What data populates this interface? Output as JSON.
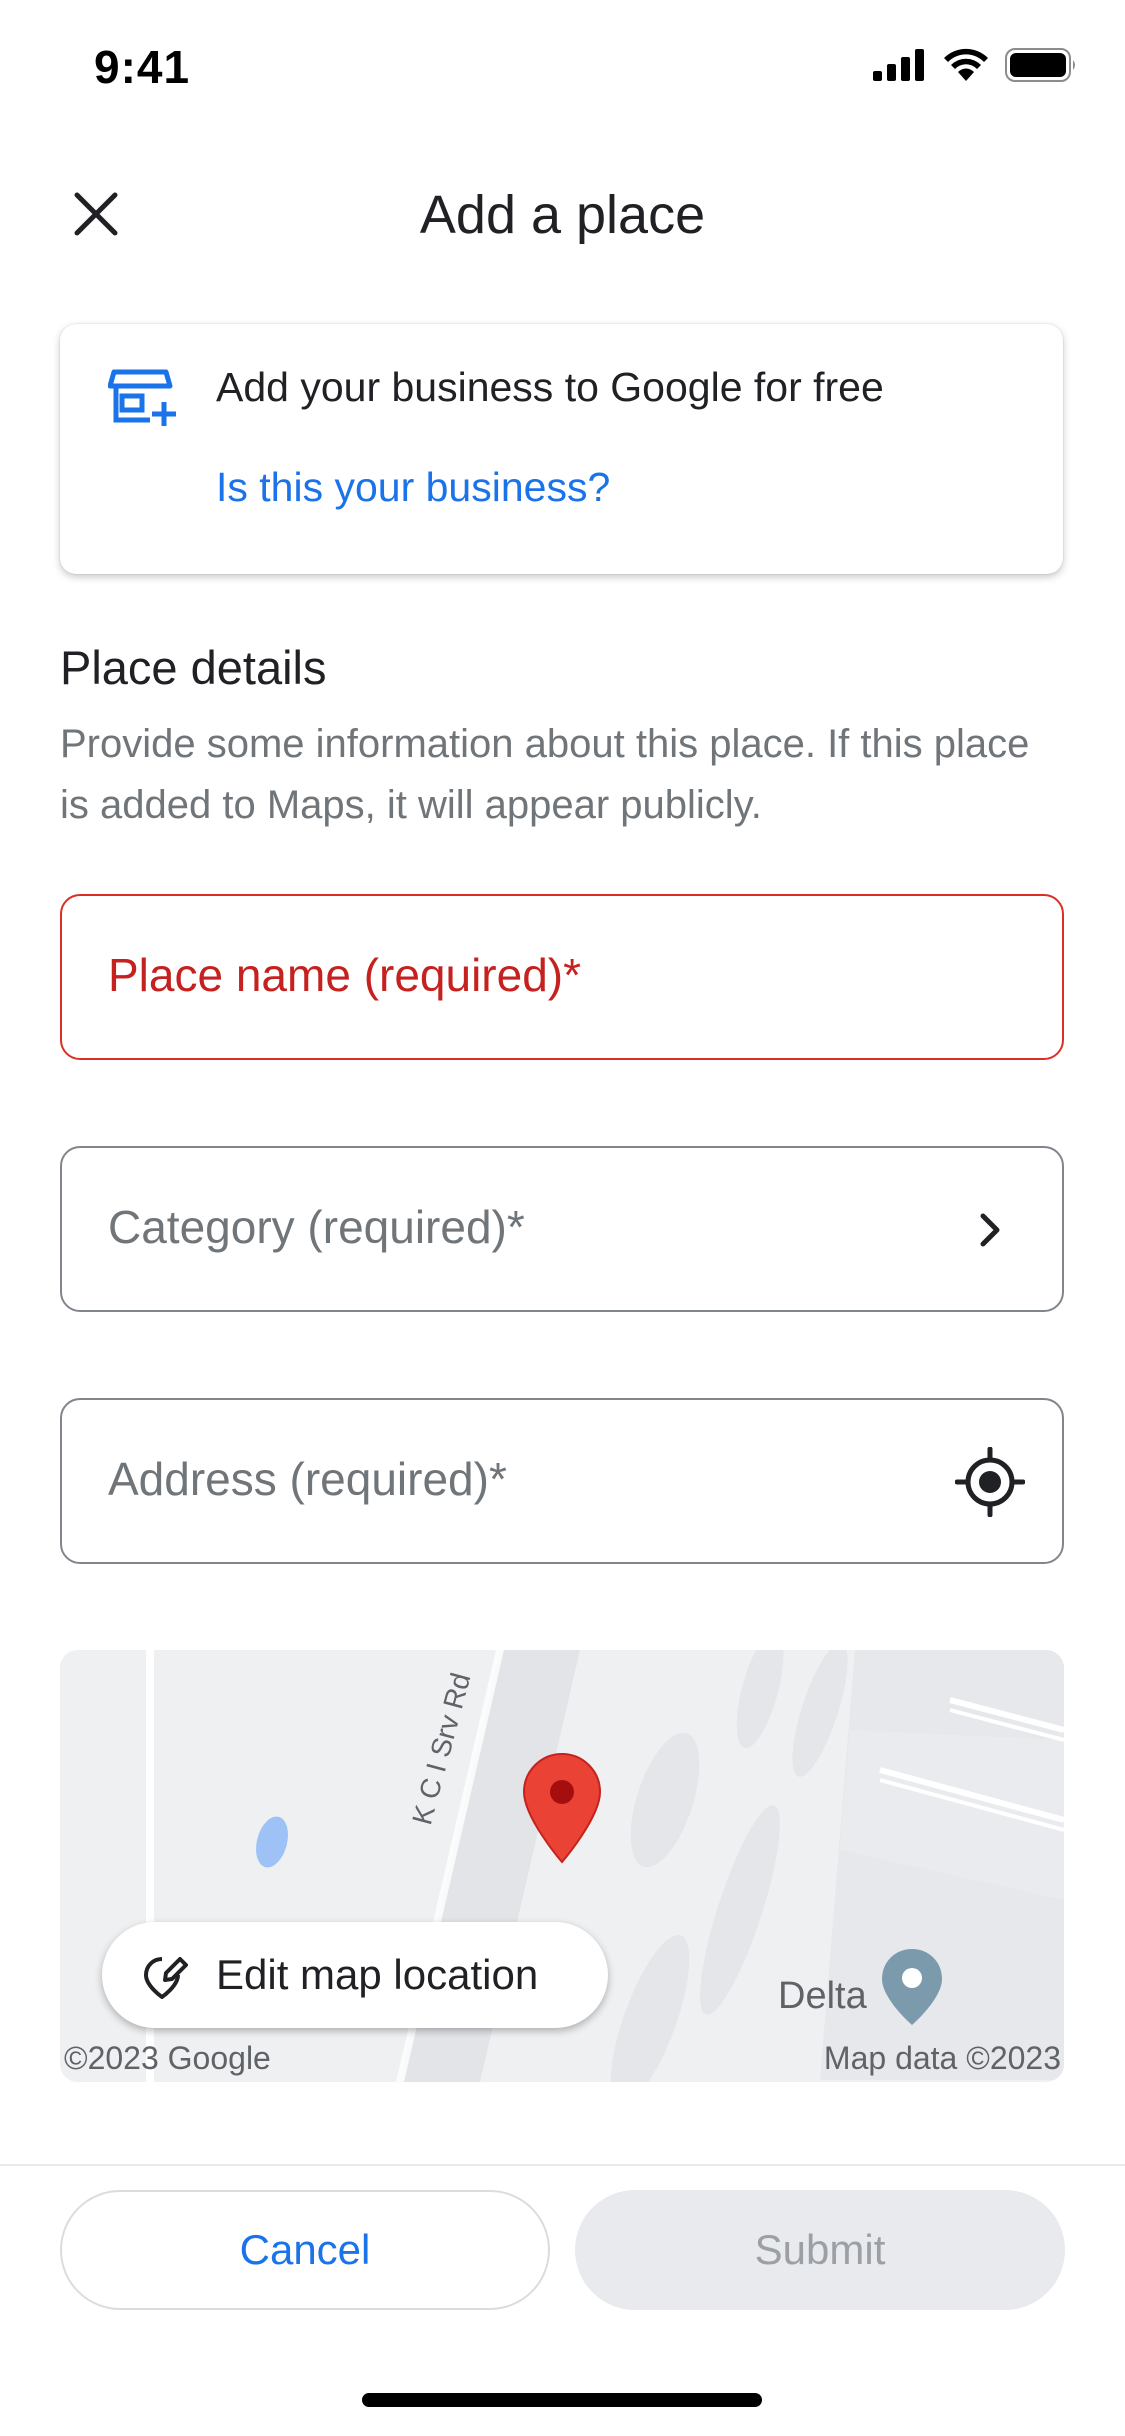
{
  "status_bar": {
    "time": "9:41"
  },
  "header": {
    "title": "Add a place"
  },
  "business_card": {
    "text": "Add your business to Google for free",
    "link": "Is this your business?"
  },
  "section": {
    "title": "Place details",
    "description": "Provide some information about this place. If this place is added to Maps, it will appear publicly."
  },
  "fields": {
    "place_name": "Place name (required)*",
    "category": "Category (required)*",
    "address": "Address (required)*"
  },
  "map": {
    "road_label": "K C I Srv Rd",
    "poi_label": "Delta",
    "edit_button": "Edit map location",
    "copyright": "©2023 Google",
    "map_data": "Map data ©2023"
  },
  "footer": {
    "cancel": "Cancel",
    "submit": "Submit"
  },
  "colors": {
    "accent": "#1a73e8",
    "error": "#d93025",
    "pin": "#ea4335"
  },
  "icons": [
    "close-icon",
    "store-add-icon",
    "chevron-right-icon",
    "my-location-icon",
    "map-pin-icon",
    "edit-location-icon",
    "signal-icon",
    "wifi-icon",
    "battery-icon"
  ]
}
